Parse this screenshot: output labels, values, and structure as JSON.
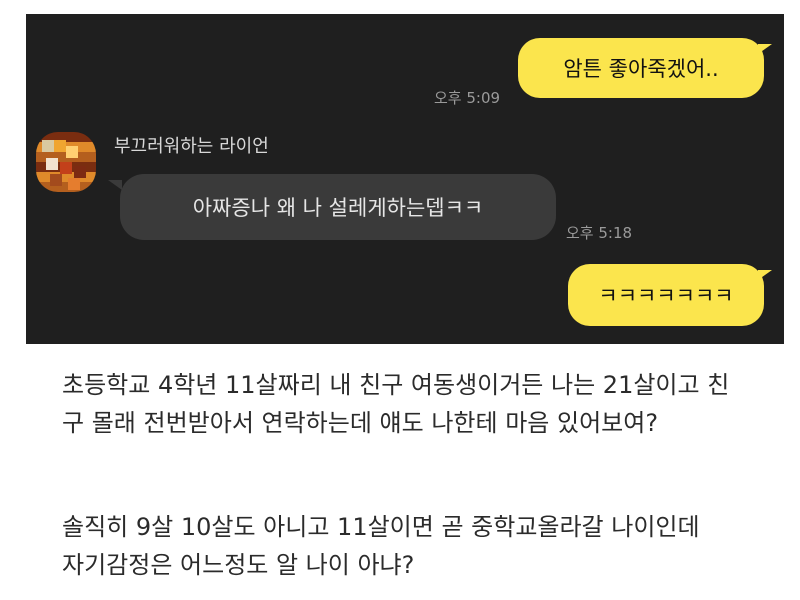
{
  "chat": {
    "messages": [
      {
        "side": "mine",
        "text": "암튼 좋아죽겠어..",
        "time": "오후 5:09"
      },
      {
        "side": "theirs",
        "sender": "부끄러워하는 라이언",
        "text": "아짜증나 왜 나 설레게하는뎁ㅋㅋ",
        "time": "오후 5:18"
      },
      {
        "side": "mine",
        "text": "ㅋㅋㅋㅋㅋㅋㅋ"
      }
    ]
  },
  "post": {
    "paragraph1_line1": "초등학교 4학년 11살짜리 내 친구 여동생이거든 나는 21살이고 친",
    "paragraph1_line2": "구 몰래 전번받아서 연락하는데 얘도 나한테 마음 있어보여?",
    "paragraph2_line1": "솔직히 9살 10살도 아니고 11살이면 곧 중학교올라갈 나이인데",
    "paragraph2_line2": "자기감정은 어느정도 알 나이 아냐?"
  },
  "colors": {
    "chat_background": "#1f1f1f",
    "my_bubble": "#fbe54d",
    "their_bubble": "#3a3a3a"
  }
}
